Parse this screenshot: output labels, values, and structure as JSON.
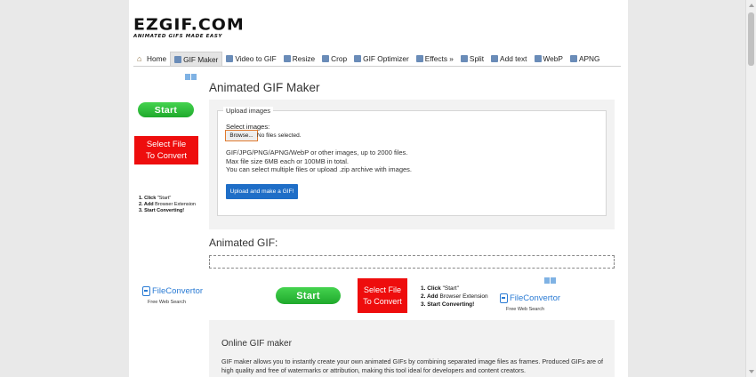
{
  "logo": {
    "main": "EZGIF.COM",
    "sub": "ANIMATED GIFS MADE EASY"
  },
  "nav": [
    {
      "label": "Home",
      "icon": "home-icon",
      "active": false
    },
    {
      "label": "GIF Maker",
      "icon": "gif-maker-icon",
      "active": true
    },
    {
      "label": "Video to GIF",
      "icon": "video-icon",
      "active": false
    },
    {
      "label": "Resize",
      "icon": "resize-icon",
      "active": false
    },
    {
      "label": "Crop",
      "icon": "crop-icon",
      "active": false
    },
    {
      "label": "GIF Optimizer",
      "icon": "optimizer-icon",
      "active": false
    },
    {
      "label": "Effects »",
      "icon": "effects-icon",
      "active": false
    },
    {
      "label": "Split",
      "icon": "split-icon",
      "active": false
    },
    {
      "label": "Add text",
      "icon": "add-text-icon",
      "active": false
    },
    {
      "label": "WebP",
      "icon": "webp-icon",
      "active": false
    },
    {
      "label": "APNG",
      "icon": "apng-icon",
      "active": false
    }
  ],
  "left_ad": {
    "start": "Start",
    "select_file_line1": "Select File",
    "select_file_line2": "To Convert",
    "step1_b": "1. Click",
    "step1": "\"Start\"",
    "step2_b": "2. Add",
    "step2": "Browser Extension",
    "step3_b": "3. Start Converting!"
  },
  "main": {
    "title": "Animated GIF Maker",
    "legend": "Upload images",
    "select_label": "Select images:",
    "browse": "Browse...",
    "no_files": "No files selected.",
    "info_line1": "GIF/JPG/PNG/APNG/WebP or other images, up to 2000 files.",
    "info_line2": "Max file size 6MB each or 100MB in total.",
    "info_line3": "You can select multiple files or upload .zip archive with images.",
    "submit": "Upload and make a GIF!",
    "animated_gif_title": "Animated GIF:"
  },
  "bottom_ad": {
    "fc_name": "FileConvertor",
    "fc_sub": "Free Web Search",
    "start": "Start",
    "select_file_line1": "Select File",
    "select_file_line2": "To Convert",
    "step1_b": "1. Click",
    "step1": "\"Start\"",
    "step2_b": "2. Add",
    "step2": "Browser Extension",
    "step3_b": "3. Start Converting!"
  },
  "online": {
    "title": "Online GIF maker",
    "desc": "GIF maker allows you to instantly create your own animated GIFs by combining separated image files as frames. Produced GIFs are of high quality and free of watermarks or attribution, making this tool ideal for developers and content creators."
  },
  "colors": {
    "accent": "#1f6ec7",
    "ad_red": "#ee0d0d",
    "ad_green": "#22b02f",
    "browse_border": "#e07a2e"
  }
}
